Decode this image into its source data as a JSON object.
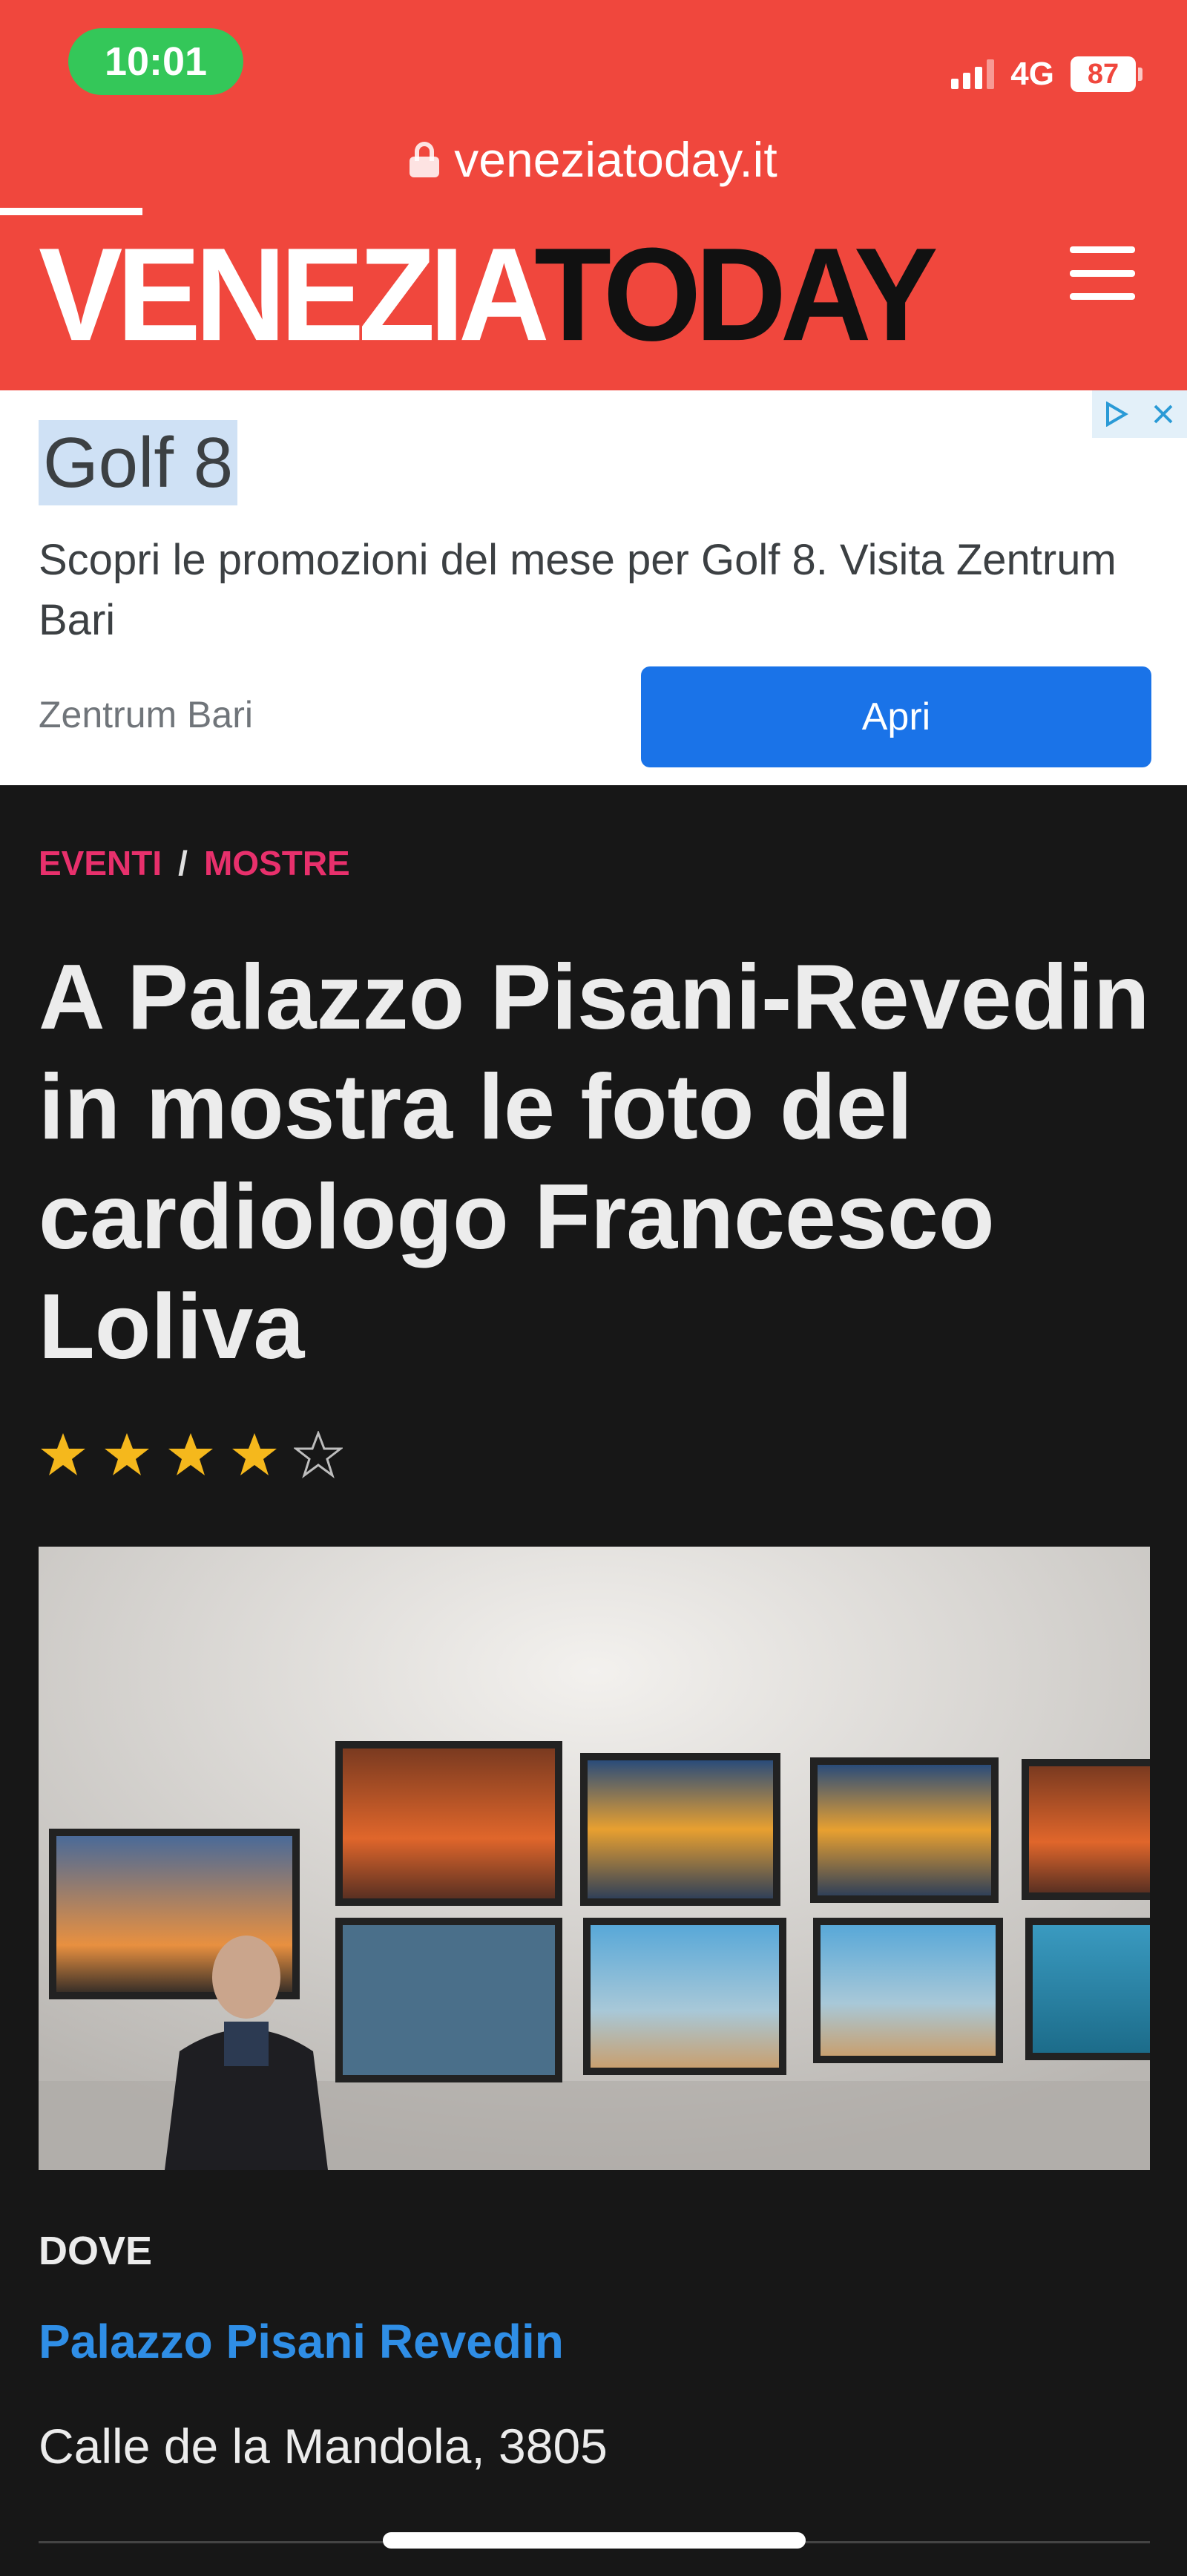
{
  "status": {
    "time": "10:01",
    "network": "4G",
    "battery": "87",
    "signal_bars": 4,
    "signal_bars_active": 3
  },
  "browser": {
    "url": "veneziatoday.it",
    "icons": [
      "lock-icon"
    ]
  },
  "site": {
    "logo_part1": "VENEZIA",
    "logo_part2": "TODAY",
    "brand_color": "#f0473d",
    "icons": [
      "hamburger-menu-icon"
    ]
  },
  "ad": {
    "title": "Golf 8",
    "text": "Scopri le promozioni del mese per Golf 8. Visita Zentrum Bari",
    "source": "Zentrum Bari",
    "button_label": "Apri",
    "icons": [
      "adchoices-icon",
      "close-icon"
    ]
  },
  "article": {
    "breadcrumb": [
      "EVENTI",
      "MOSTRE"
    ],
    "breadcrumb_separator": "/",
    "headline": "A Palazzo Pisani-Revedin in mostra le foto del cardiologo Francesco Loliva",
    "rating": 4,
    "rating_max": 5,
    "where_label": "DOVE",
    "place_name": "Palazzo Pisani Revedin",
    "address": "Calle de la Mandola, 3805"
  },
  "colors": {
    "category": "#e8306c",
    "link": "#2f8ee6",
    "star": "#f5b81c",
    "ad_button": "#1a73e8"
  }
}
